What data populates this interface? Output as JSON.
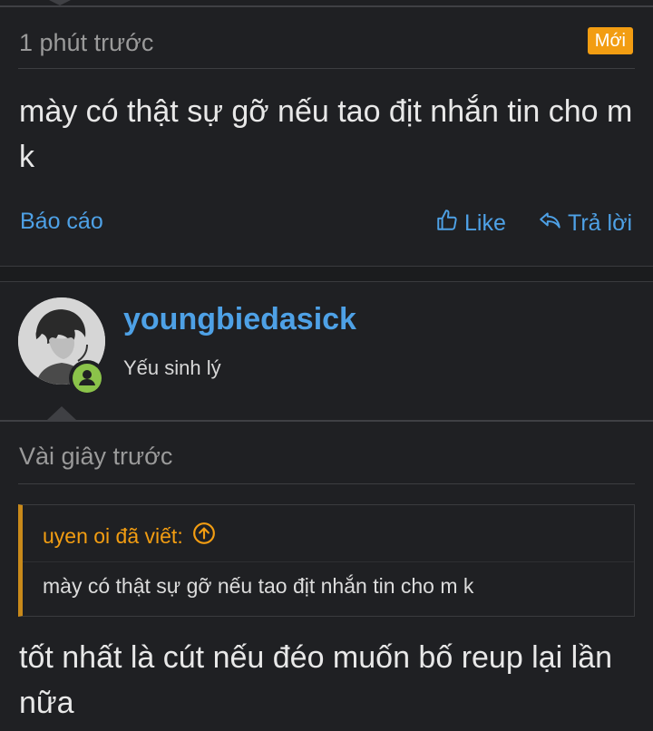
{
  "post1": {
    "timestamp": "1 phút trước",
    "badge": "Mới",
    "message": "mày có thật sự gỡ nếu tao địt nhắn tin cho m k",
    "actions": {
      "report": "Báo cáo",
      "like": "Like",
      "reply": "Trả lời"
    }
  },
  "post2": {
    "user": {
      "name": "youngbiedasick",
      "title": "Yếu sinh lý",
      "avatar_icon": "user-avatar",
      "status_icon": "online-status-icon"
    },
    "timestamp": "Vài giây trước",
    "quote": {
      "author": "uyen oi đã viết:",
      "text": "mày có thật sự gỡ nếu tao địt nhắn tin cho m k"
    },
    "message": "tốt nhất là cút nếu đéo muốn bố reup lại lần nữa"
  },
  "colors": {
    "background": "#1f2023",
    "link": "#4ea1e6",
    "badge": "#f29d12",
    "quote_accent": "#c98a1a",
    "online": "#8bc34a"
  }
}
